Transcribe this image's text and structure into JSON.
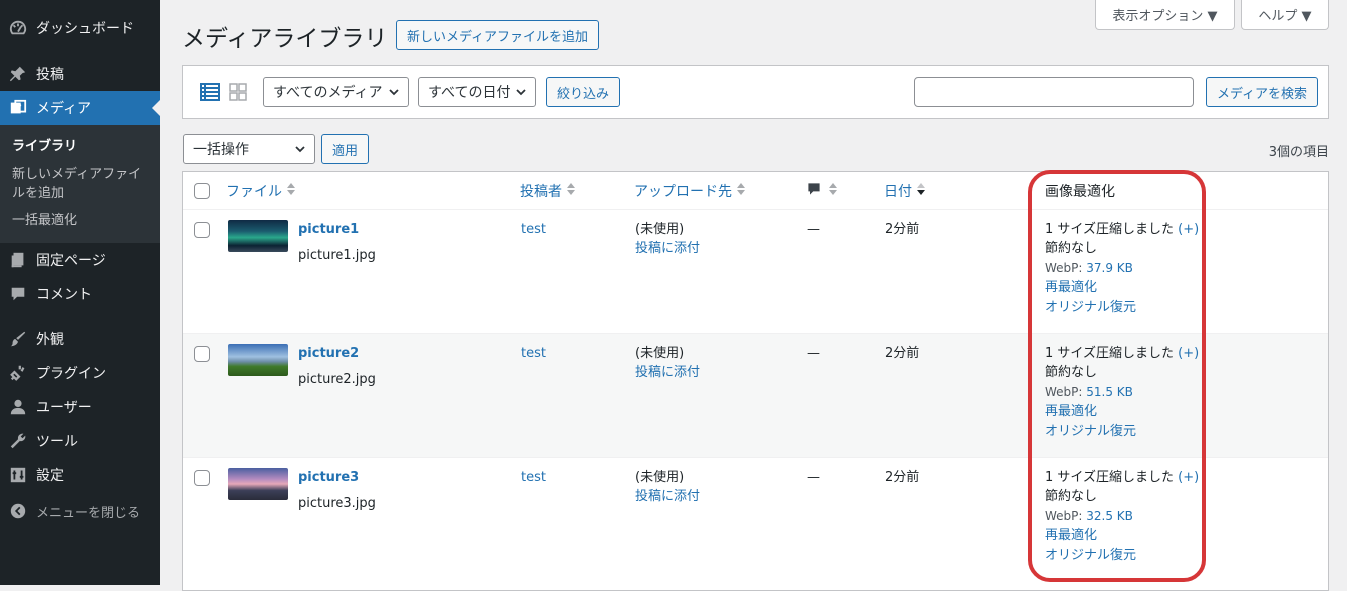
{
  "sidebar": {
    "items": [
      {
        "label": "ダッシュボード",
        "icon": "dashboard-icon"
      },
      {
        "label": "投稿",
        "icon": "pin-icon"
      },
      {
        "label": "メディア",
        "icon": "media-icon"
      },
      {
        "label": "固定ページ",
        "icon": "page-icon"
      },
      {
        "label": "コメント",
        "icon": "comment-icon"
      },
      {
        "label": "外観",
        "icon": "brush-icon"
      },
      {
        "label": "プラグイン",
        "icon": "plugin-icon"
      },
      {
        "label": "ユーザー",
        "icon": "user-icon"
      },
      {
        "label": "ツール",
        "icon": "wrench-icon"
      },
      {
        "label": "設定",
        "icon": "settings-icon"
      }
    ],
    "submenu": [
      "ライブラリ",
      "新しいメディアファイルを追加",
      "一括最適化"
    ],
    "collapse": "メニューを閉じる"
  },
  "header": {
    "title": "メディアライブラリ",
    "add_new": "新しいメディアファイルを追加",
    "screen_options": "表示オプション ▼",
    "help": "ヘルプ ▼"
  },
  "filters": {
    "media_type": "すべてのメディア",
    "date": "すべての日付",
    "filter_button": "絞り込み",
    "search_button": "メディアを検索",
    "search_value": ""
  },
  "bulk": {
    "action": "一括操作",
    "apply": "適用",
    "count": "3個の項目"
  },
  "columns": {
    "file": "ファイル",
    "author": "投稿者",
    "uploaded_to": "アップロード先",
    "date": "日付",
    "optimization": "画像最適化"
  },
  "rows": [
    {
      "title": "picture1",
      "filename": "picture1.jpg",
      "author": "test",
      "uploaded": "(未使用)",
      "attach": "投稿に添付",
      "comments": "—",
      "date": "2分前",
      "opt1": "1 サイズ圧縮しました",
      "opt_plus": "(+)",
      "saving": "節約なし",
      "webp_label": "WebP: ",
      "webp": "37.9 KB",
      "reopt": "再最適化",
      "restore": "オリジナル復元"
    },
    {
      "title": "picture2",
      "filename": "picture2.jpg",
      "author": "test",
      "uploaded": "(未使用)",
      "attach": "投稿に添付",
      "comments": "—",
      "date": "2分前",
      "opt1": "1 サイズ圧縮しました",
      "opt_plus": "(+)",
      "saving": "節約なし",
      "webp_label": "WebP: ",
      "webp": "51.5 KB",
      "reopt": "再最適化",
      "restore": "オリジナル復元"
    },
    {
      "title": "picture3",
      "filename": "picture3.jpg",
      "author": "test",
      "uploaded": "(未使用)",
      "attach": "投稿に添付",
      "comments": "—",
      "date": "2分前",
      "opt1": "1 サイズ圧縮しました",
      "opt_plus": "(+)",
      "saving": "節約なし",
      "webp_label": "WebP: ",
      "webp": "32.5 KB",
      "reopt": "再最適化",
      "restore": "オリジナル復元"
    }
  ],
  "colors": {
    "accent": "#2271b1",
    "sidebar": "#1d2327",
    "highlight": "#d63638"
  }
}
